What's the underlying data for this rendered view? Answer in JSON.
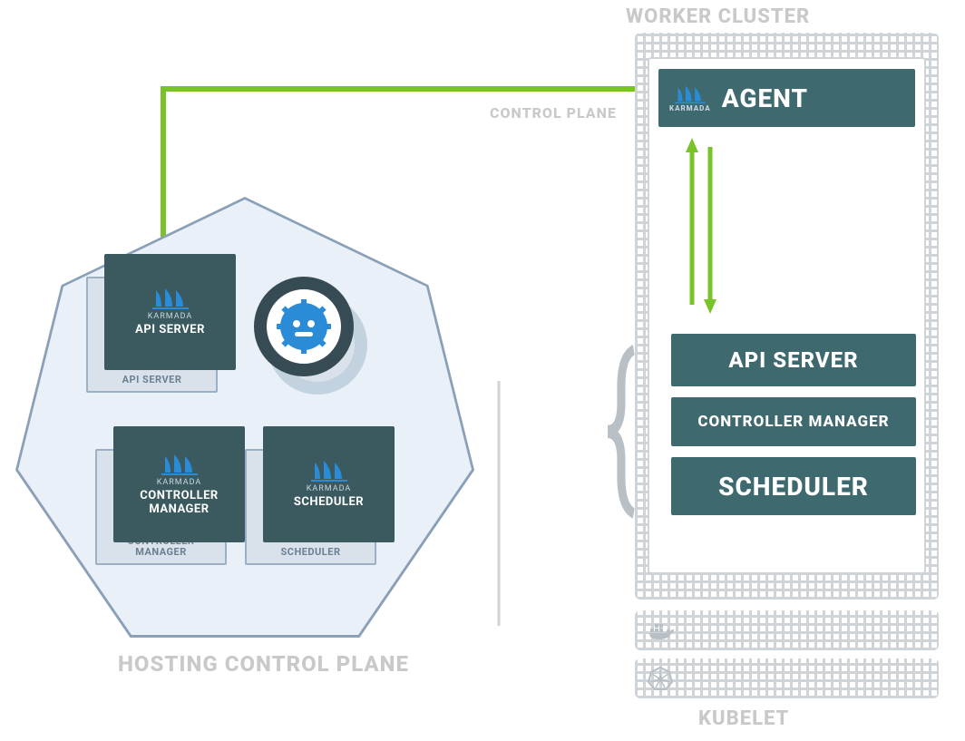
{
  "captions": {
    "top": "WORKER CLUSTER",
    "bottom_left": "HOSTING CONTROL PLANE",
    "stack_top": "CONTROL PLANE",
    "stack_bottom": "KUBELET"
  },
  "control_plane": {
    "api_server": {
      "brand": "KARMADA",
      "label": "API SERVER",
      "shadow_label": "API SERVER"
    },
    "controller_manager": {
      "brand": "KARMADA",
      "label": "CONTROLLER MANAGER",
      "shadow_label": "CONTROLLER MANAGER"
    },
    "scheduler": {
      "brand": "KARMADA",
      "label": "SCHEDULER",
      "shadow_label": "SCHEDULER"
    }
  },
  "worker": {
    "agent": {
      "brand": "KARMADA",
      "label": "AGENT"
    },
    "components": {
      "api_server": "API SERVER",
      "controller_manager": "CONTROLLER MANAGER",
      "scheduler": "SCHEDULER"
    }
  },
  "colors": {
    "box": "#3a5a5f",
    "right_box": "#3e6a6f",
    "green": "#78c327",
    "pale_bg": "#e9f0f7",
    "grey_line": "#cfd4d8"
  }
}
